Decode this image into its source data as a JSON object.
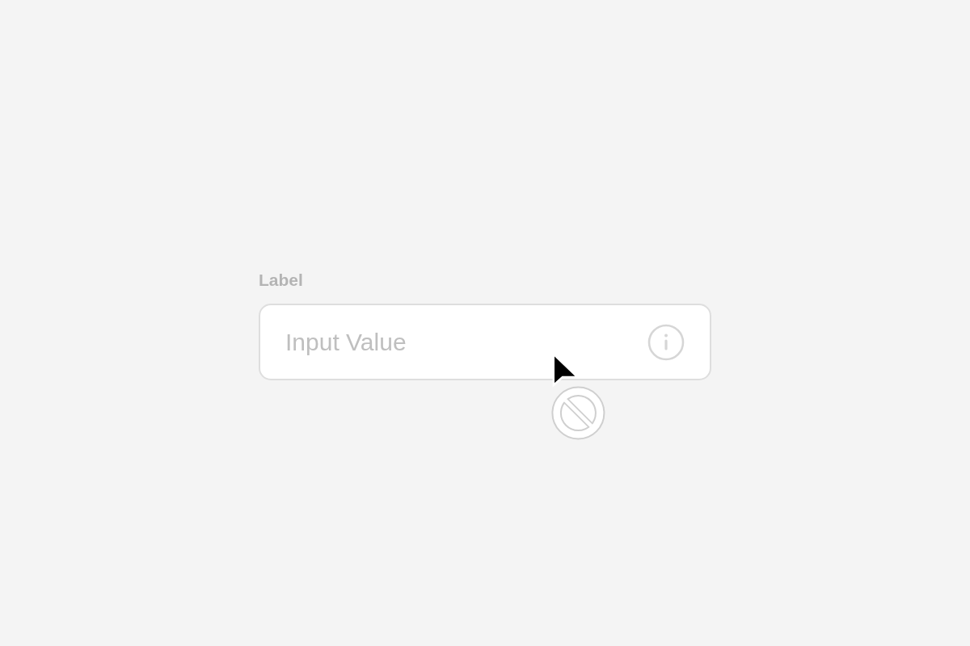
{
  "field": {
    "label": "Label",
    "value": "Input Value",
    "disabled": true
  }
}
